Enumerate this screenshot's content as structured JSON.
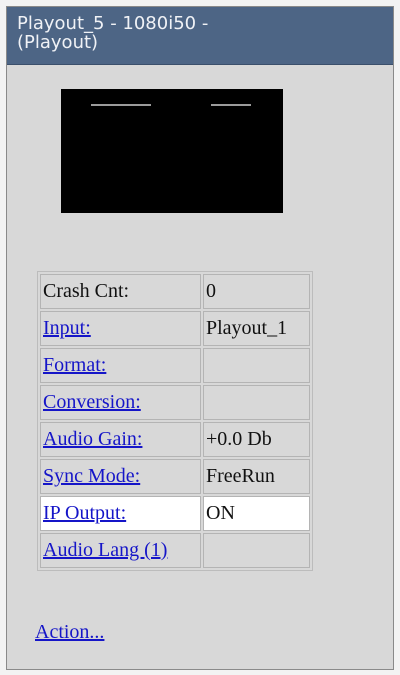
{
  "header": {
    "line1": "Playout_5 - 1080i50 -",
    "line2": "(Playout)"
  },
  "preview": {
    "label": "video thumbnail"
  },
  "properties": [
    {
      "label": "Crash Cnt:",
      "value": "0",
      "link": false
    },
    {
      "label": "Input:",
      "value": "Playout_1",
      "link": true
    },
    {
      "label": "Format:",
      "value": "",
      "link": true
    },
    {
      "label": "Conversion:",
      "value": "",
      "link": true
    },
    {
      "label": "Audio Gain:",
      "value": "+0.0 Db",
      "link": true
    },
    {
      "label": "Sync Mode:",
      "value": "FreeRun",
      "link": true
    },
    {
      "label": "IP Output:",
      "value": "ON",
      "link": true,
      "highlight": true
    },
    {
      "label": "Audio Lang (1)",
      "value": "",
      "link": true
    }
  ],
  "action": {
    "label": "Action..."
  },
  "colors": {
    "header_bg": "#4d6585",
    "link": "#1515c8",
    "panel_bg": "#d8d8d8"
  }
}
